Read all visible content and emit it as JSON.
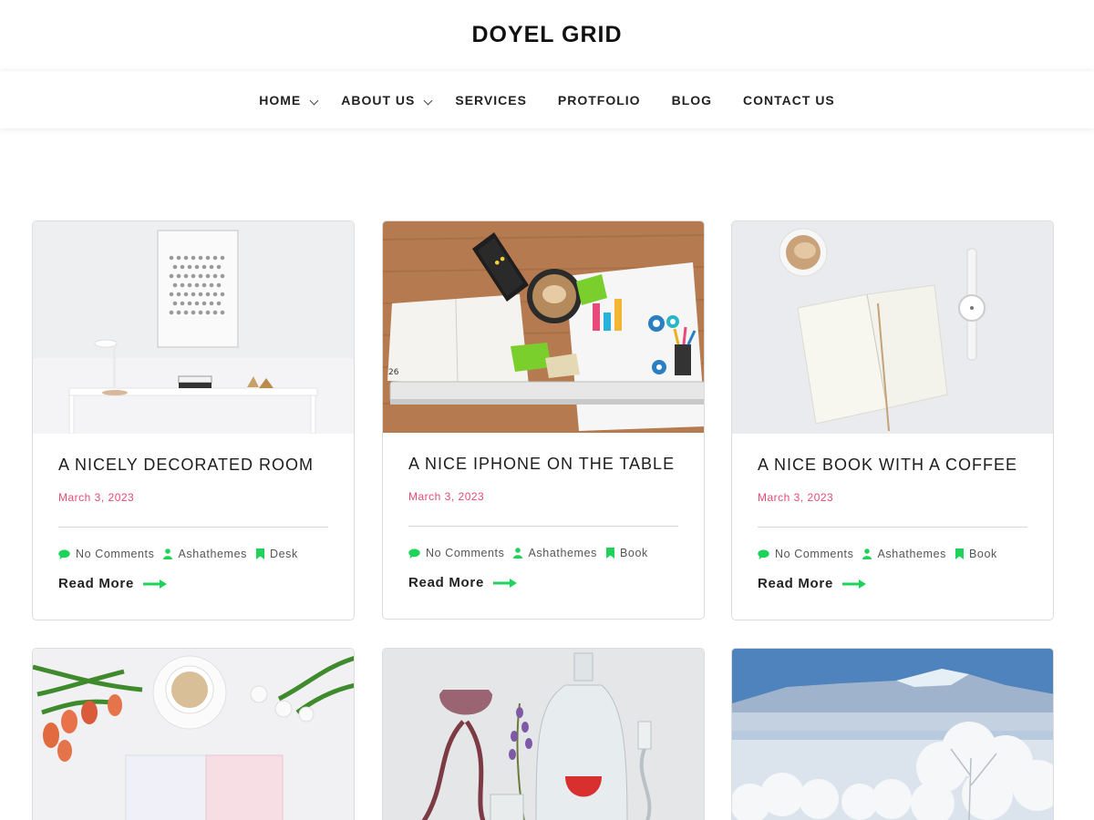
{
  "site": {
    "title": "DOYEL GRID"
  },
  "nav": {
    "items": [
      {
        "label": "HOME",
        "has_submenu": true
      },
      {
        "label": "ABOUT US",
        "has_submenu": true
      },
      {
        "label": "SERVICES",
        "has_submenu": false
      },
      {
        "label": "PROTFOLIO",
        "has_submenu": false
      },
      {
        "label": "BLOG",
        "has_submenu": false
      },
      {
        "label": "CONTACT US",
        "has_submenu": false
      }
    ]
  },
  "colors": {
    "accent_green": "#1fd35a",
    "date_pink": "#e74a74"
  },
  "posts": [
    {
      "title": "A NICELY DECORATED ROOM",
      "date": "March 3, 2023",
      "comments": "No Comments",
      "author": "Ashathemes",
      "category": "Desk",
      "read_more": "Read More",
      "image": "white-desk-room"
    },
    {
      "title": "A NICE IPHONE ON THE TABLE",
      "date": "March 3, 2023",
      "comments": "No Comments",
      "author": "Ashathemes",
      "category": "Book",
      "read_more": "Read More",
      "image": "phone-on-wooden-table"
    },
    {
      "title": "A NICE BOOK WITH A COFFEE",
      "date": "March 3, 2023",
      "comments": "No Comments",
      "author": "Ashathemes",
      "category": "Book",
      "read_more": "Read More",
      "image": "notebook-coffee-watch"
    },
    {
      "image": "tulips-coffee-notebook"
    },
    {
      "image": "glassware-lavender"
    },
    {
      "image": "snowy-mountain-trees"
    }
  ]
}
